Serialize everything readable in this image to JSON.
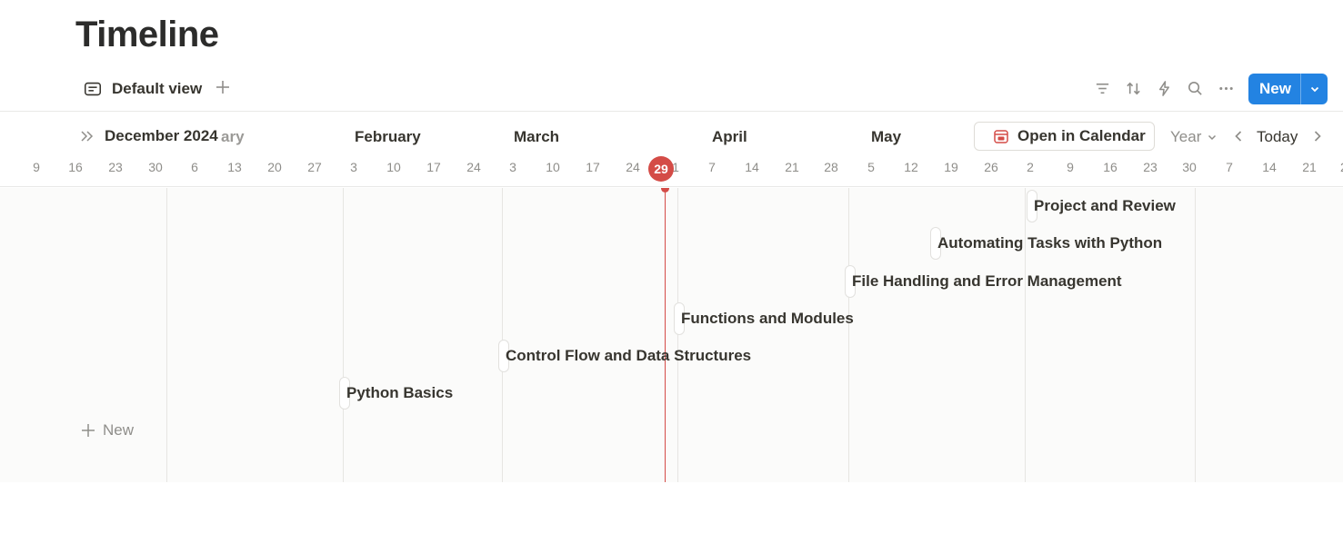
{
  "page": {
    "title": "Timeline"
  },
  "views": {
    "active": "Default view"
  },
  "toolbar": {
    "new_label": "New"
  },
  "timeline": {
    "current_month": "December 2024",
    "months": [
      {
        "label": "ary",
        "faded": true
      },
      {
        "label": "February",
        "faded": false
      },
      {
        "label": "March",
        "faded": false
      },
      {
        "label": "April",
        "faded": false
      },
      {
        "label": "May",
        "faded": false
      }
    ],
    "days": [
      "9",
      "16",
      "23",
      "30",
      "6",
      "13",
      "20",
      "27",
      "3",
      "10",
      "17",
      "24",
      "3",
      "10",
      "17",
      "24",
      "1",
      "7",
      "14",
      "21",
      "28",
      "5",
      "12",
      "19",
      "26",
      "2",
      "9",
      "16",
      "23",
      "30",
      "7",
      "14",
      "21",
      "2"
    ],
    "today": "29",
    "open_calendar": "Open in Calendar",
    "scale": "Year",
    "today_button": "Today"
  },
  "tasks": [
    {
      "label": "Project and Review"
    },
    {
      "label": "Automating Tasks with Python"
    },
    {
      "label": "File Handling and Error Management"
    },
    {
      "label": "Functions and Modules"
    },
    {
      "label": "Control Flow and Data Structures"
    },
    {
      "label": "Python Basics"
    }
  ],
  "add_row": {
    "label": "New"
  },
  "colors": {
    "accent": "#2383e2",
    "today": "#d44c47"
  }
}
